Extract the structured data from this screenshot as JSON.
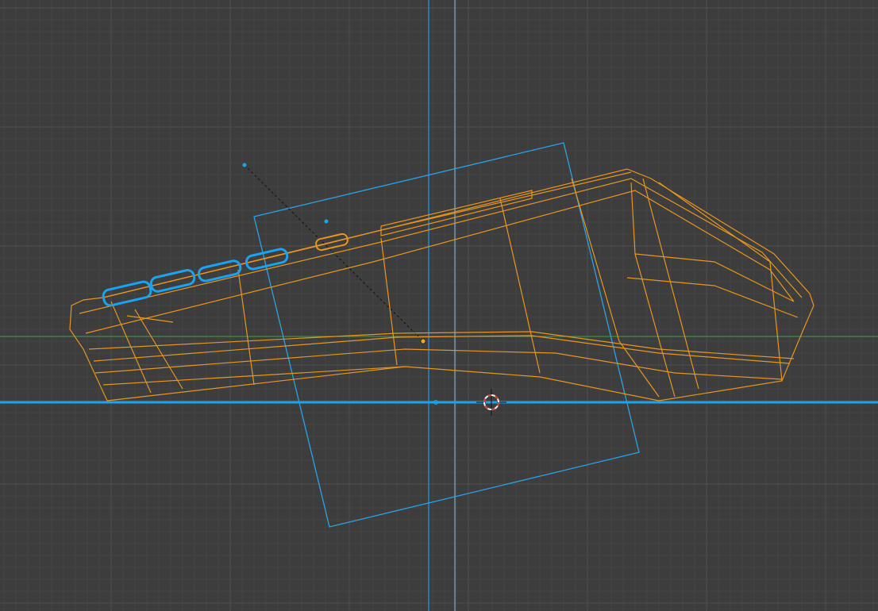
{
  "viewport": {
    "mode": "wireframe",
    "background_color": "#3d3d3d",
    "grid_minor_color": "#454545",
    "grid_major_color": "#4d4d4d"
  },
  "colors": {
    "wireframe": "#e8961e",
    "selected": "#1aa3f0",
    "x_axis": "#4a9a4a",
    "frame": "#29a3e6",
    "cursor_red": "#d23c3c",
    "cursor_white": "#f0f0f0"
  },
  "objects": [
    {
      "name": "device-body",
      "state": "selected-active"
    },
    {
      "name": "button-group",
      "state": "selected"
    },
    {
      "name": "camera-frame",
      "state": "visible"
    }
  ]
}
